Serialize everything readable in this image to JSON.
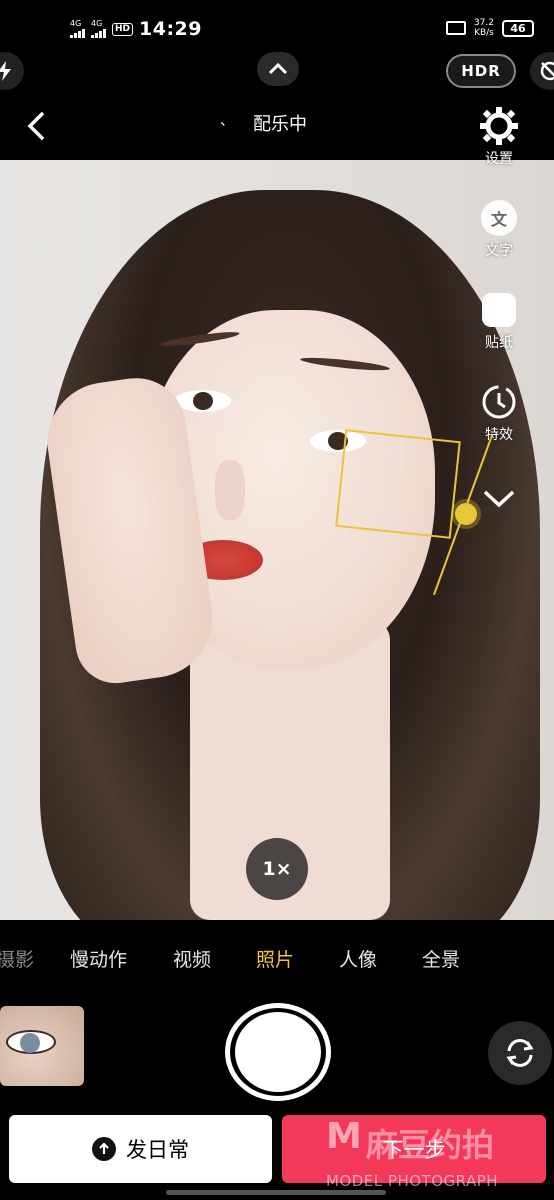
{
  "status_bar": {
    "signal1": "4G",
    "signal2": "4G",
    "hd": "HD",
    "time": "14:29",
    "speed_value": "37.2",
    "speed_unit": "KB/s",
    "battery": "46"
  },
  "top": {
    "hdr_label": "HDR",
    "title": "配乐中",
    "title_mark": "、"
  },
  "side_tools": [
    {
      "label": "设置",
      "icon": "gear-icon"
    },
    {
      "label": "文字",
      "icon": "text-icon",
      "glyph": "文"
    },
    {
      "label": "贴纸",
      "icon": "sticker-icon"
    },
    {
      "label": "特效",
      "icon": "timer-effect-icon"
    }
  ],
  "zoom": "1×",
  "modes": [
    "摄影",
    "慢动作",
    "视频",
    "照片",
    "人像",
    "全景"
  ],
  "active_mode": "照片",
  "buttons": {
    "daily": "发日常",
    "next": "下一步"
  },
  "watermark": {
    "brand": "M",
    "cn": "麻豆约拍",
    "en": "MODEL PHOTOGRAPH"
  },
  "colors": {
    "accent_yellow": "#f0c53a",
    "next_red": "#f4385a"
  }
}
